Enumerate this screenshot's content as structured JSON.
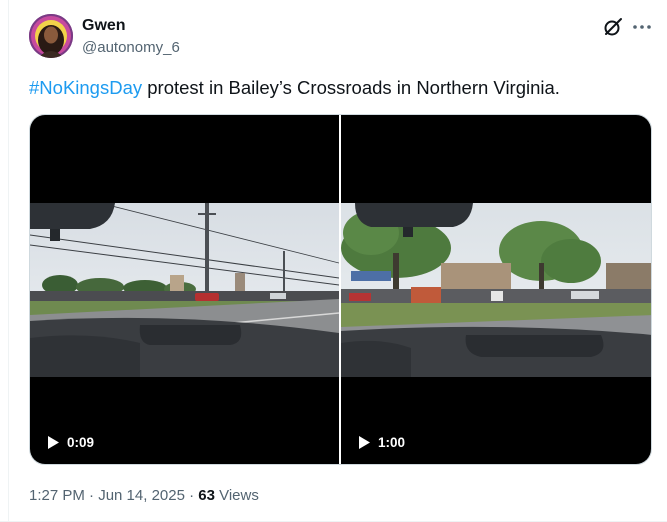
{
  "author": {
    "name": "Gwen",
    "handle": "@autonomy_6"
  },
  "tweet": {
    "hashtag": "#NoKingsDay",
    "text": " protest in Bailey’s Crossroads in Northern Virginia."
  },
  "media": {
    "videos": [
      {
        "duration": "0:09"
      },
      {
        "duration": "1:00"
      }
    ]
  },
  "meta": {
    "timestamp": "1:27 PM · Jun 14, 2025 · ",
    "view_count": "63",
    "views_label": " Views"
  },
  "icons": {
    "grok": "grok-icon",
    "more": "more-options-icon",
    "play": "play-icon"
  },
  "colors": {
    "link": "#1d9bf0",
    "secondary_text": "#536471",
    "primary_text": "#0f1419"
  }
}
